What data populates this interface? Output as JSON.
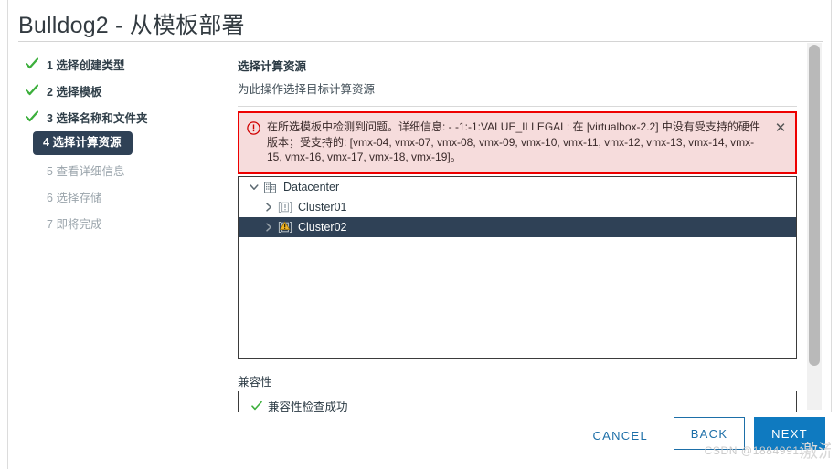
{
  "window": {
    "title": "Bulldog2 - 从模板部署"
  },
  "sidebar": {
    "steps": [
      {
        "num": "1",
        "label": "选择创建类型",
        "state": "done"
      },
      {
        "num": "2",
        "label": "选择模板",
        "state": "done"
      },
      {
        "num": "3",
        "label": "选择名称和文件夹",
        "state": "done"
      },
      {
        "num": "4",
        "label": "选择计算资源",
        "state": "active"
      },
      {
        "num": "5",
        "label": "查看详细信息",
        "state": "pending"
      },
      {
        "num": "6",
        "label": "选择存储",
        "state": "pending"
      },
      {
        "num": "7",
        "label": "即将完成",
        "state": "pending"
      }
    ]
  },
  "panel": {
    "title": "选择计算资源",
    "subtitle": "为此操作选择目标计算资源"
  },
  "error": {
    "icon": "error-circle-icon",
    "message": "在所选模板中检测到问题。详细信息: - -1:-1:VALUE_ILLEGAL: 在 [virtualbox-2.2] 中没有受支持的硬件版本；受支持的: [vmx-04, vmx-07, vmx-08, vmx-09, vmx-10, vmx-11, vmx-12, vmx-13, vmx-14, vmx-15, vmx-16, vmx-17, vmx-18, vmx-19]。",
    "close_label": "✕",
    "border_color": "#ee0000",
    "background_color": "#f6dcdc"
  },
  "tree": {
    "nodes": [
      {
        "label": "Datacenter",
        "level": 1,
        "expanded": true,
        "twisty": "chevron-down-icon",
        "icon": "datacenter-icon",
        "selected": false,
        "warning": false
      },
      {
        "label": "Cluster01",
        "level": 2,
        "expanded": false,
        "twisty": "chevron-right-icon",
        "icon": "cluster-icon",
        "selected": false,
        "warning": false
      },
      {
        "label": "Cluster02",
        "level": 2,
        "expanded": false,
        "twisty": "chevron-right-icon",
        "icon": "cluster-warning-icon",
        "selected": true,
        "warning": true
      }
    ],
    "selected_color": "#2f4156"
  },
  "compatibility": {
    "heading": "兼容性",
    "status": "兼容性检查成功"
  },
  "footer": {
    "cancel_label": "CANCEL",
    "back_label": "BACK",
    "next_label": "NEXT",
    "accent_color": "#0f7ac0",
    "link_color": "#1d6fa8"
  },
  "scrollbar": {
    "name": "vertical-scrollbar"
  },
  "watermark": {
    "text": "CSDN @18849911",
    "overlay": "激流"
  }
}
